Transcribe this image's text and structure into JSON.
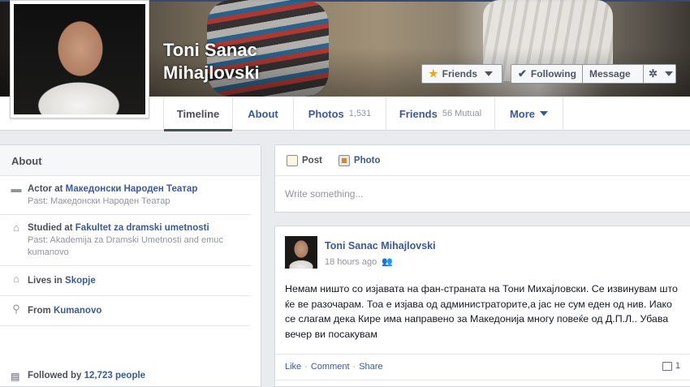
{
  "profile": {
    "name_line1": "Toni Sanac",
    "name_line2": "Mihajlovski"
  },
  "actions": {
    "friends": "Friends",
    "following": "Following",
    "message": "Message"
  },
  "nav": {
    "tabs": [
      {
        "label": "Timeline"
      },
      {
        "label": "About"
      },
      {
        "label": "Photos",
        "count": "1,531"
      },
      {
        "label": "Friends",
        "count": "56 Mutual"
      },
      {
        "label": "More"
      }
    ]
  },
  "about": {
    "title": "About",
    "work": {
      "prefix": "Actor at ",
      "link": "Македонски Народен Театар",
      "past": "Past: Македонски Народен Театар"
    },
    "education": {
      "prefix": "Studied at ",
      "link": "Fakultet za dramski umetnosti",
      "past": "Past: Akademija za Dramski Umetnosti and emuc kumanovo"
    },
    "lives": {
      "prefix": "Lives in ",
      "link": "Skopje"
    },
    "from": {
      "prefix": "From ",
      "link": "Kumanovo"
    },
    "followed": {
      "prefix": "Followed by ",
      "link": "12,723 people"
    }
  },
  "composer": {
    "tab_post": "Post",
    "tab_photo": "Photo",
    "placeholder": "Write something..."
  },
  "story": {
    "author": "Toni Sanac Mihajlovski",
    "time": "18 hours ago",
    "text": "Немам ништо со изјавата на фан-страната на Тони Михајловски. Се извинувам што ќе ве разочарам. Тоа е изјава од администраторите,а јас не сум еден од нив. Иако се слагам дека Кире има направено за Македонија многу повеќе од Д.П.Л.. Убава вечер ви посакувам",
    "like": "Like",
    "comment": "Comment",
    "share": "Share",
    "comments_count": "1"
  }
}
